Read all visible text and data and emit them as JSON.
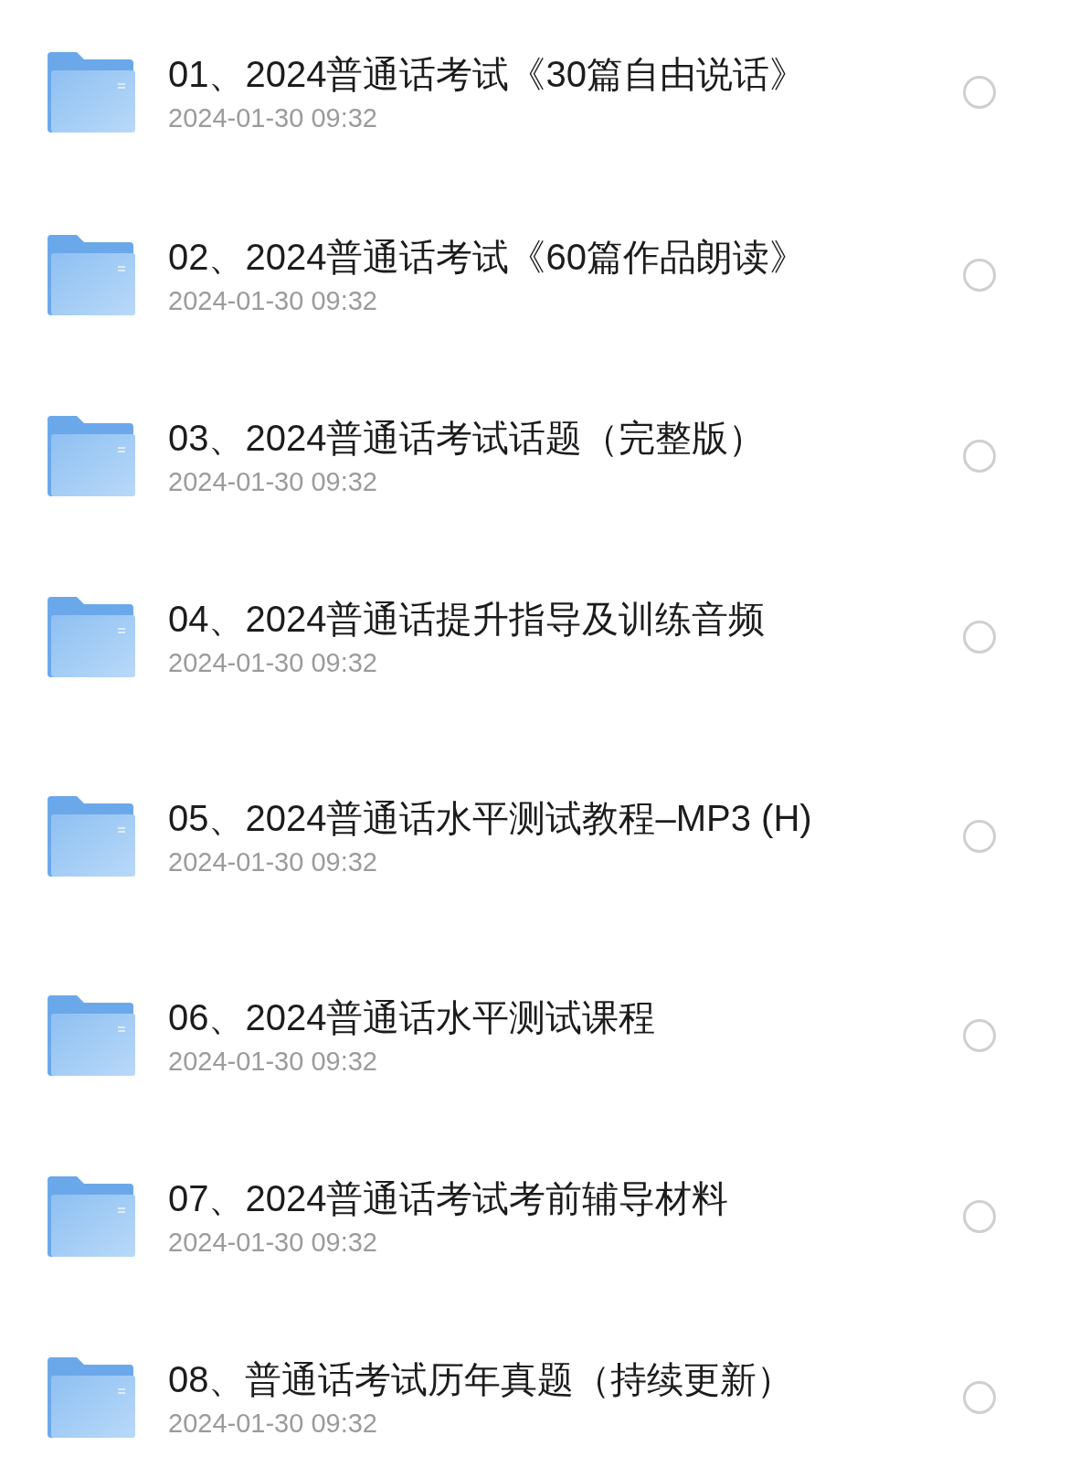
{
  "files": [
    {
      "title": "01、2024普通话考试《30篇自由说话》",
      "date": "2024-01-30 09:32",
      "selected": false
    },
    {
      "title": "02、2024普通话考试《60篇作品朗读》",
      "date": "2024-01-30 09:32",
      "selected": false
    },
    {
      "title": "03、2024普通话考试话题（完整版）",
      "date": "2024-01-30 09:32",
      "selected": false
    },
    {
      "title": "04、2024普通话提升指导及训练音频",
      "date": "2024-01-30 09:32",
      "selected": false
    },
    {
      "title": "05、2024普通话水平测试教程–MP3 (H)",
      "date": "2024-01-30 09:32",
      "selected": false
    },
    {
      "title": "06、2024普通话水平测试课程",
      "date": "2024-01-30 09:32",
      "selected": false
    },
    {
      "title": "07、2024普通话考试考前辅导材料",
      "date": "2024-01-30 09:32",
      "selected": false
    },
    {
      "title": "08、普通话考试历年真题（持续更新）",
      "date": "2024-01-30 09:32",
      "selected": false
    }
  ]
}
